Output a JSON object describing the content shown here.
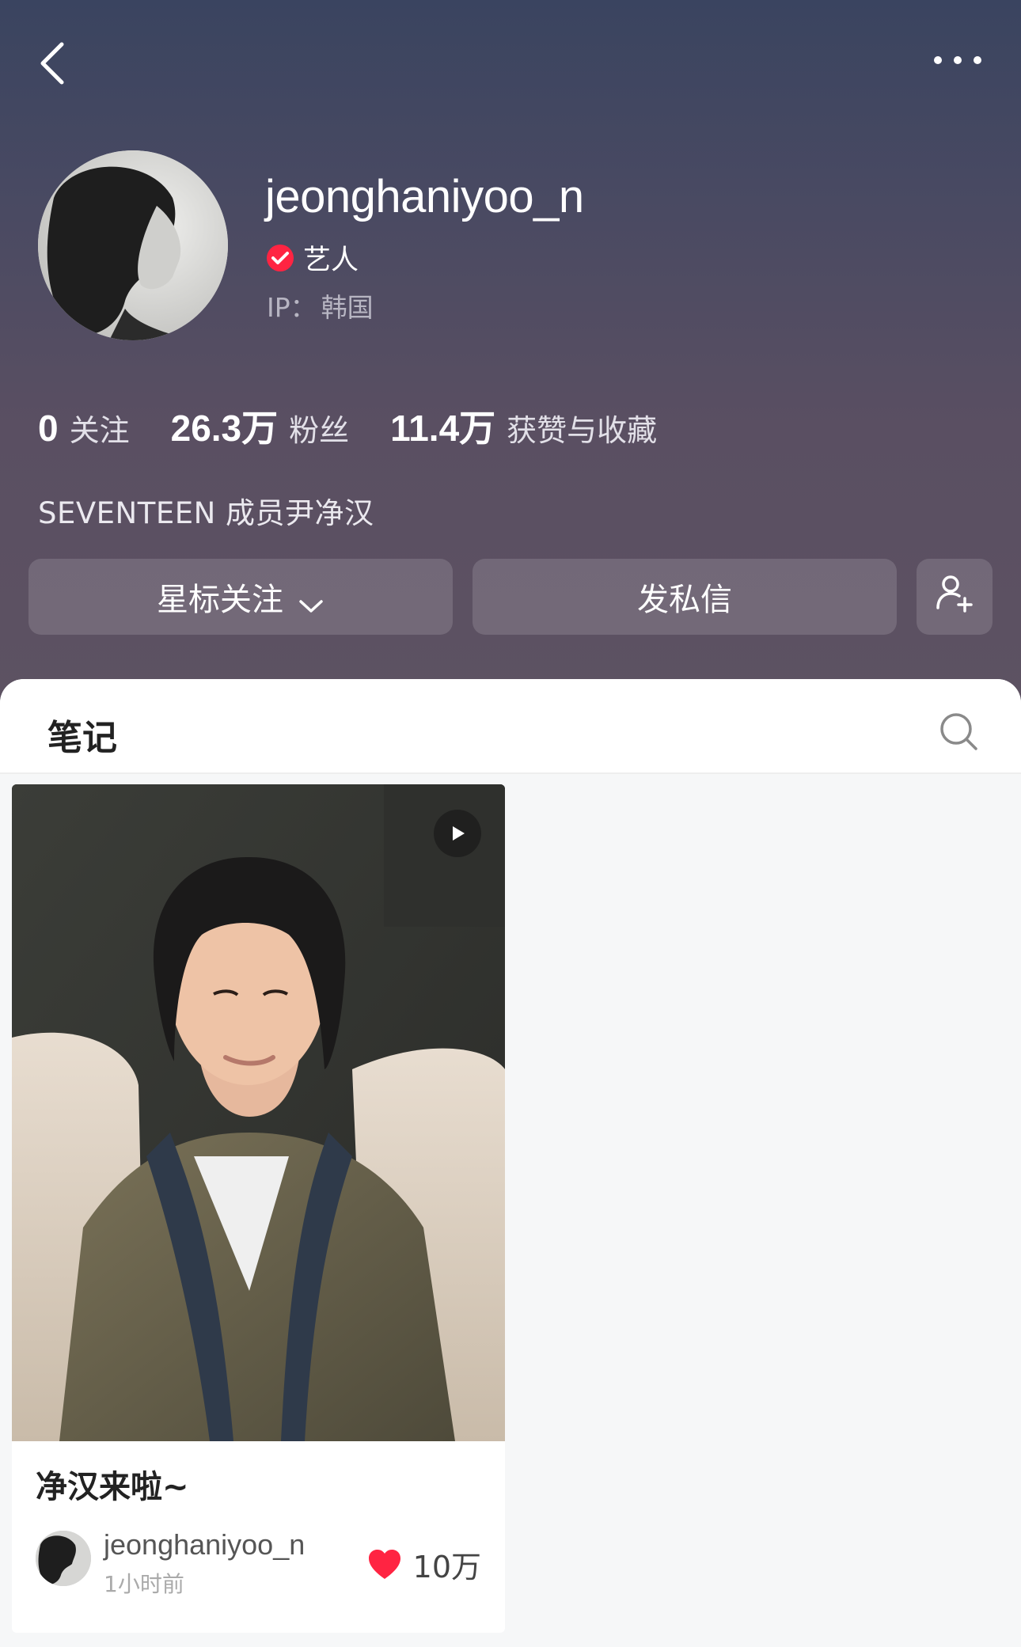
{
  "header": {
    "back_icon": "chevron-left-icon",
    "more_icon": "more-dots-icon"
  },
  "profile": {
    "username": "jeonghaniyoo_n",
    "verified_icon": "verified-check-icon",
    "verified_color": "#ff2442",
    "role": "艺人",
    "ip_label": "IP：",
    "ip_value": "韩国",
    "bio": "SEVENTEEN 成员尹净汉"
  },
  "stats": [
    {
      "value": "0",
      "label": "关注"
    },
    {
      "value": "26.3万",
      "label": "粉丝"
    },
    {
      "value": "11.4万",
      "label": "获赞与收藏"
    }
  ],
  "actions": {
    "follow_label": "星标关注",
    "follow_icon": "chevron-down-icon",
    "message_label": "发私信",
    "add_friend_icon": "add-user-icon"
  },
  "tabs": {
    "notes_label": "笔记",
    "search_icon": "search-icon"
  },
  "notes": [
    {
      "title": "净汉来啦~",
      "author": "jeonghaniyoo_n",
      "time": "1小时前",
      "likes": "10万",
      "is_video": true
    }
  ],
  "colors": {
    "accent": "#ff2442",
    "header_top": "#3a4460",
    "header_bottom": "#5d5262"
  }
}
